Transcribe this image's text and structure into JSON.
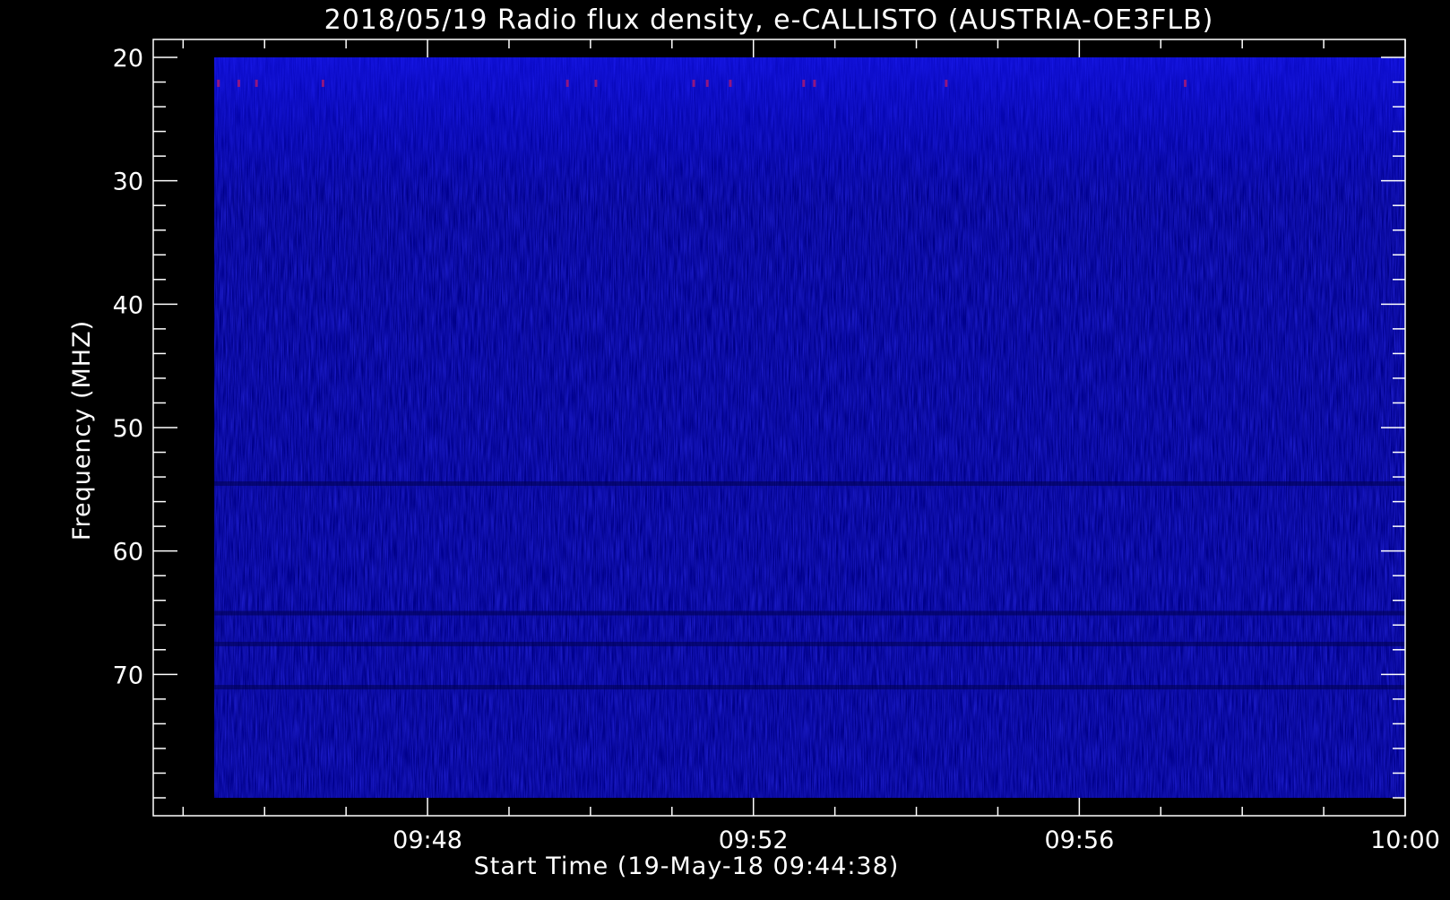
{
  "chart_data": {
    "type": "heatmap",
    "title": "2018/05/19  Radio flux density, e-CALLISTO (AUSTRIA-OE3FLB)",
    "xlabel": "Start Time (19-May-18 09:44:38)",
    "ylabel": "Frequency (MHZ)",
    "x_range": [
      "09:44:38",
      "10:00:00"
    ],
    "x_ticks": [
      "09:48",
      "09:52",
      "09:56",
      "10:00"
    ],
    "y_range": [
      20,
      80
    ],
    "y_ticks": [
      20,
      30,
      40,
      50,
      60,
      70
    ],
    "y_inverted": true,
    "data_x_range": [
      "09:45:23",
      "10:00:00"
    ],
    "data_y_range": [
      20,
      80
    ],
    "colormap": {
      "low": "#00008c",
      "mid": "#0b0bd8",
      "high": "#ff1a1a"
    },
    "features": [
      {
        "label": "red flux spikes",
        "y": 22.1,
        "x": [
          "09:45:26",
          "09:45:41",
          "09:45:54",
          "09:46:43",
          "09:49:43",
          "09:50:04",
          "09:51:16",
          "09:51:26",
          "09:51:43",
          "09:52:37",
          "09:52:45",
          "09:54:22",
          "09:57:18"
        ]
      },
      {
        "label": "bright band",
        "y": [
          20,
          32
        ]
      },
      {
        "label": "dark bands",
        "y": [
          54.5,
          65,
          67.5,
          71
        ]
      }
    ],
    "colors": {
      "background": "#000000",
      "axes": "#ffffff"
    }
  }
}
